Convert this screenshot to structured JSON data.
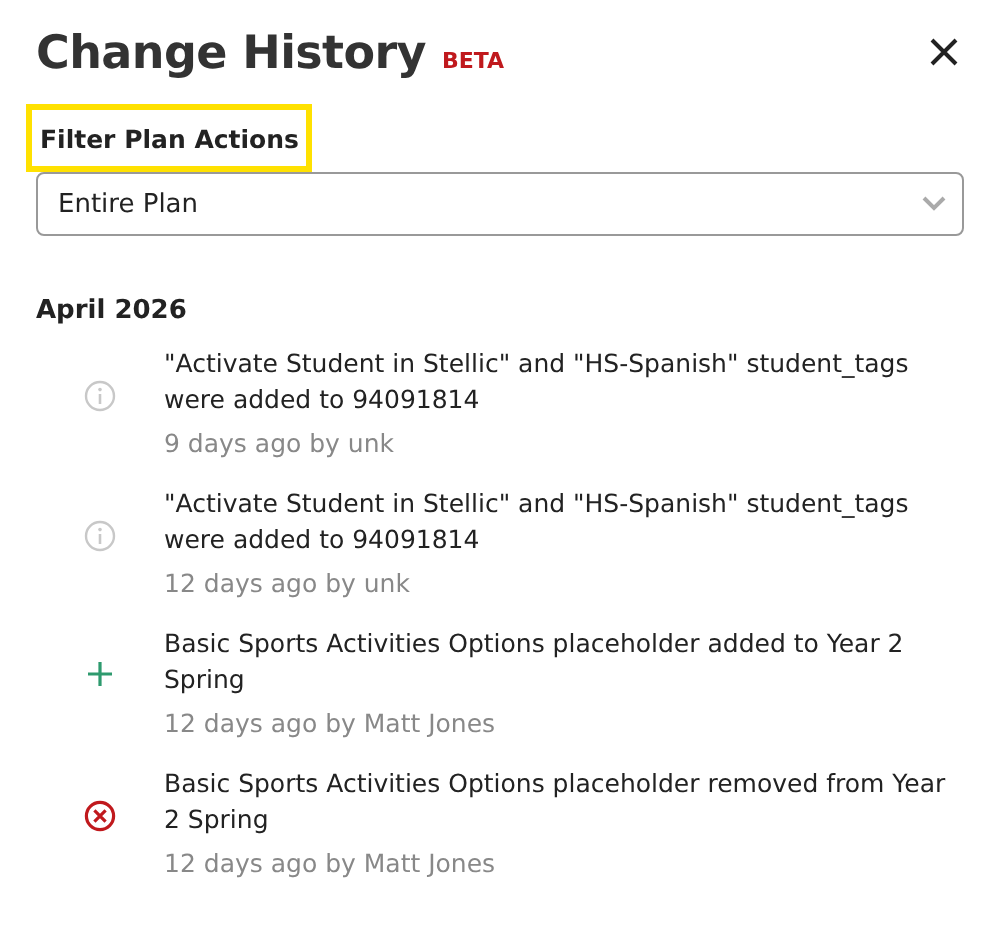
{
  "panel": {
    "title": "Change History",
    "badge": "BETA"
  },
  "filter": {
    "label": "Filter Plan Actions",
    "highlighted": true,
    "value": "Entire Plan"
  },
  "groups": [
    {
      "heading": "April 2026",
      "entries": [
        {
          "kind": "info",
          "text": "\"Activate Student in Stellic\" and \"HS-Spanish\" student_tags were added to 94091814",
          "meta": "9 days ago by unk"
        },
        {
          "kind": "info",
          "text": "\"Activate Student in Stellic\" and \"HS-Spanish\" student_tags were added to 94091814",
          "meta": "12 days ago by unk"
        },
        {
          "kind": "added",
          "text": "Basic Sports Activities Options placeholder added to Year 2 Spring",
          "meta": "12 days ago by Matt Jones"
        },
        {
          "kind": "removed",
          "text": "Basic Sports Activities Options placeholder removed from Year 2 Spring",
          "meta": "12 days ago by Matt Jones"
        }
      ]
    }
  ]
}
